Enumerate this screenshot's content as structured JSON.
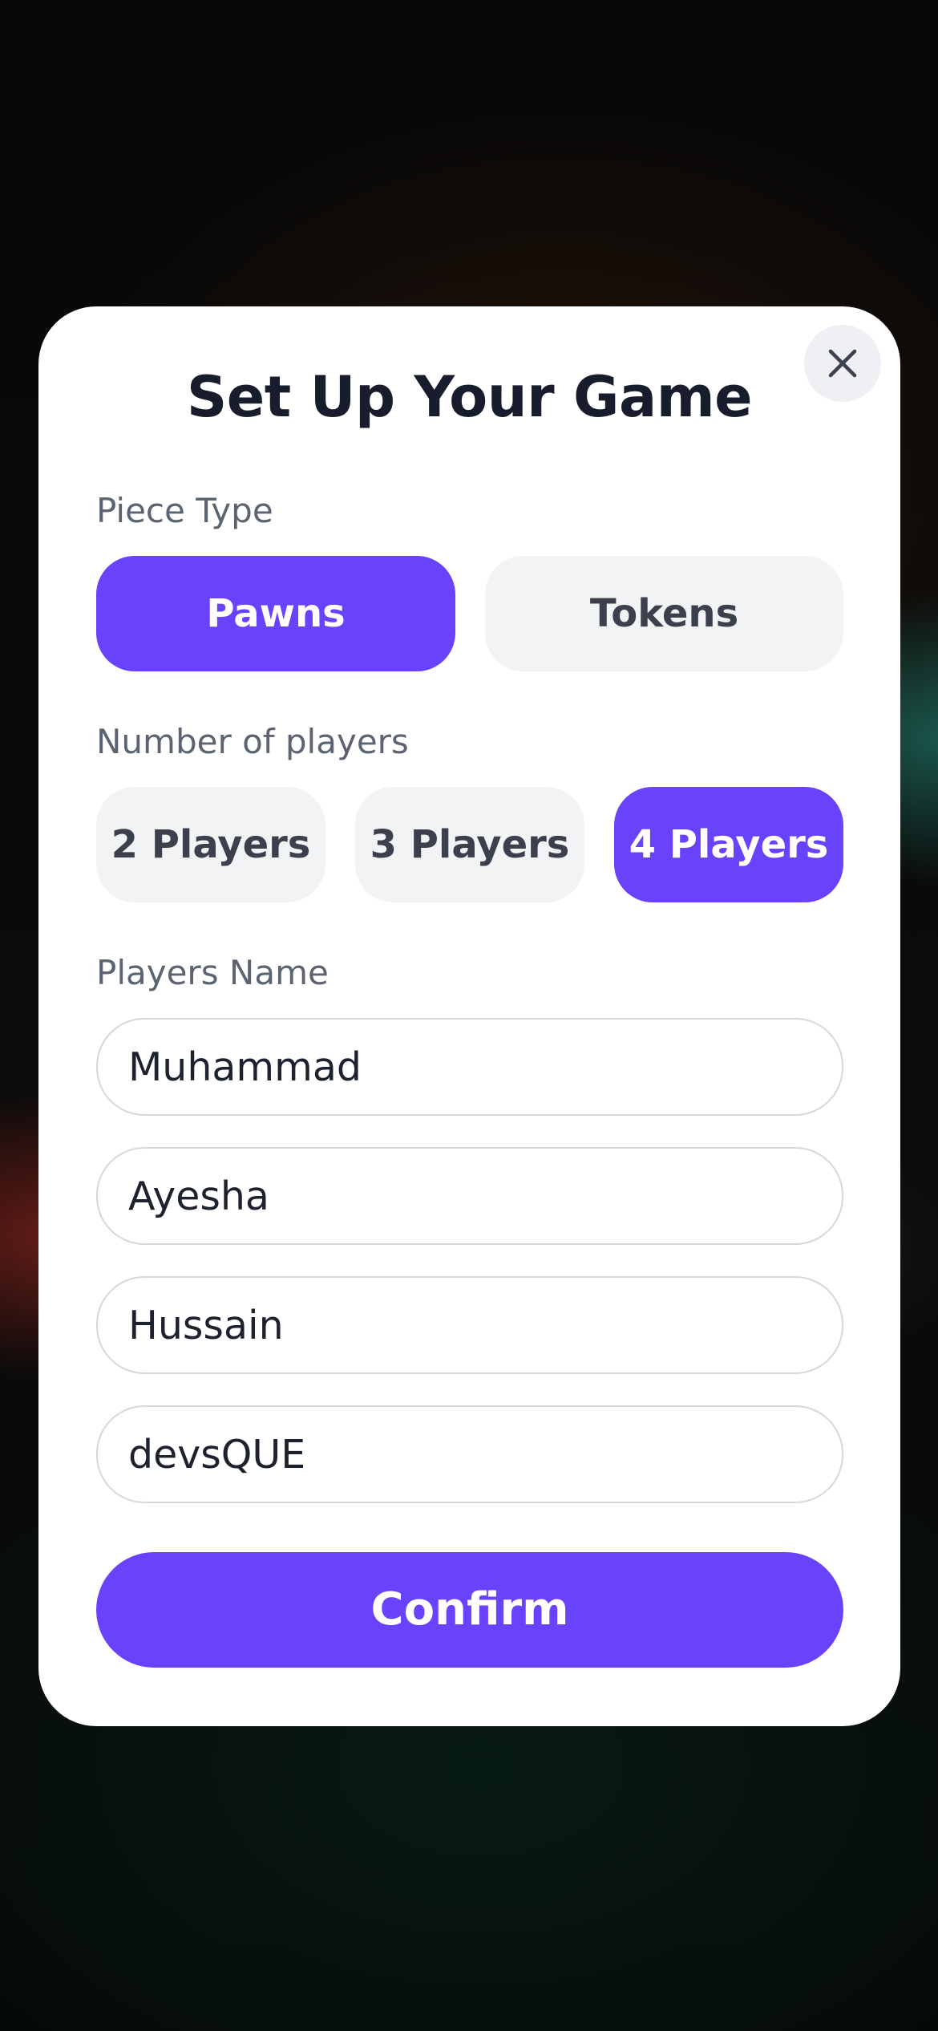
{
  "modal": {
    "title": "Set Up Your Game",
    "close_icon": "close-icon"
  },
  "piece_type": {
    "label": "Piece Type",
    "options": [
      {
        "label": "Pawns",
        "selected": true
      },
      {
        "label": "Tokens",
        "selected": false
      }
    ]
  },
  "players_count": {
    "label": "Number of players",
    "options": [
      {
        "label": "2 Players",
        "selected": false
      },
      {
        "label": "3 Players",
        "selected": false
      },
      {
        "label": "4 Players",
        "selected": true
      }
    ]
  },
  "players_name": {
    "label": "Players Name",
    "inputs": [
      {
        "value": "Muhammad"
      },
      {
        "value": "Ayesha"
      },
      {
        "value": "Hussain"
      },
      {
        "value": "devsQUE"
      }
    ]
  },
  "confirm_label": "Confirm",
  "colors": {
    "accent": "#6942fb",
    "option_bg": "#f2f3f5",
    "title": "#171d2c"
  }
}
